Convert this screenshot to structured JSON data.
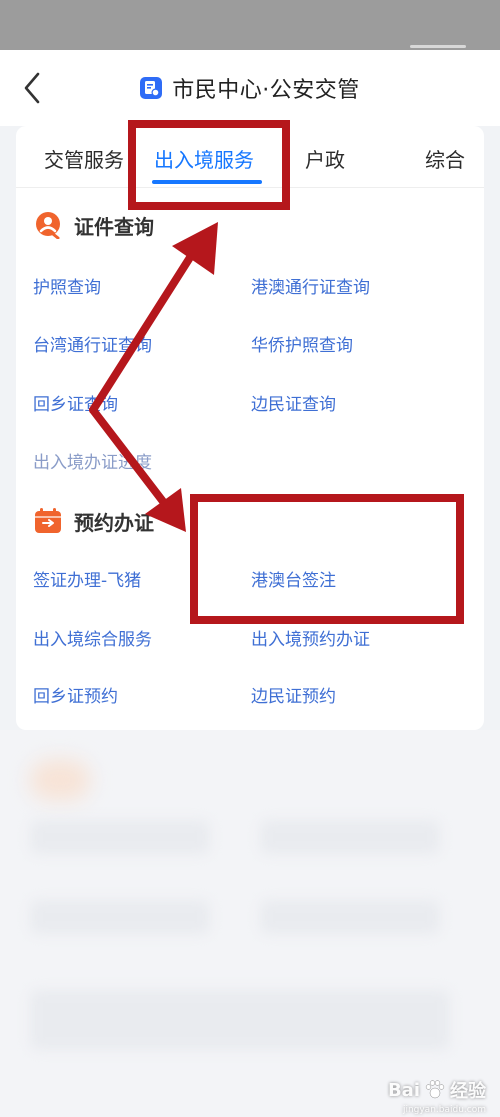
{
  "header": {
    "title": "市民中心·公安交管",
    "back_icon": "chevron-left-icon",
    "logo_icon": "document-badge-icon"
  },
  "tabs": [
    {
      "label": "交管服务",
      "active": false
    },
    {
      "label": "出入境服务",
      "active": true
    },
    {
      "label": "户政",
      "active": false
    },
    {
      "label": "综合",
      "active": false
    }
  ],
  "sections": [
    {
      "title": "证件查询",
      "icon": "search-person-icon",
      "links": [
        "护照查询",
        "港澳通行证查询",
        "台湾通行证查询",
        "华侨护照查询",
        "回乡证查询",
        "边民证查询",
        "出入境办证进度"
      ]
    },
    {
      "title": "预约办证",
      "icon": "calendar-icon",
      "links": [
        "签证办理-飞猪",
        "港澳台签注",
        "出入境综合服务",
        "出入境预约办证",
        "回乡证预约",
        "边民证预约"
      ]
    }
  ],
  "watermark": {
    "brand": "Bai",
    "suffix": "经验",
    "url": "jingyan.baidu.com"
  },
  "colors": {
    "accent": "#1677ff",
    "link": "#3f6fd4",
    "annotation": "#b5171c",
    "section_icon": "#f0642d"
  }
}
